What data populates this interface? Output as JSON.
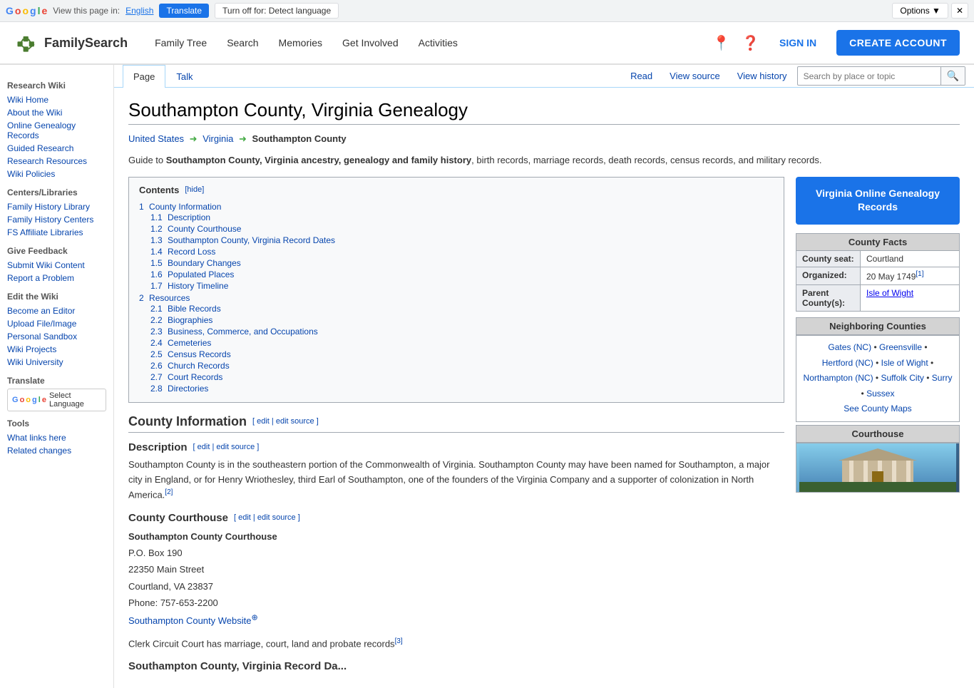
{
  "google_bar": {
    "view_text": "View this page in:",
    "language": "English",
    "translate_btn": "Translate",
    "turn_off_btn": "Turn off for: Detect language",
    "options_btn": "Options ▼",
    "close_btn": "✕"
  },
  "header": {
    "logo_text": "FamilySearch",
    "nav": [
      "Family Tree",
      "Search",
      "Memories",
      "Get Involved",
      "Activities"
    ],
    "sign_in": "SIGN IN",
    "create_account": "CREATE ACCOUNT"
  },
  "sidebar": {
    "research_wiki": "Research Wiki",
    "links1": [
      "Wiki Home",
      "About the Wiki",
      "Online Genealogy Records",
      "Guided Research",
      "Research Resources",
      "Wiki Policies"
    ],
    "centers_title": "Centers/Libraries",
    "links2": [
      "Family History Library",
      "Family History Centers",
      "FS Affiliate Libraries"
    ],
    "feedback_title": "Give Feedback",
    "links3": [
      "Submit Wiki Content",
      "Report a Problem"
    ],
    "edit_title": "Edit the Wiki",
    "links4": [
      "Become an Editor",
      "Upload File/Image",
      "Personal Sandbox",
      "Wiki Projects",
      "Wiki University"
    ],
    "translate_title": "Translate",
    "select_language": "Select Language",
    "tools_title": "Tools",
    "links5": [
      "What links here",
      "Related changes"
    ]
  },
  "tabs": {
    "page": "Page",
    "talk": "Talk",
    "read": "Read",
    "view_source": "View source",
    "view_history": "View history",
    "search_placeholder": "Search by place or topic"
  },
  "article": {
    "title": "Southampton County, Virginia Genealogy",
    "breadcrumb": {
      "us": "United States",
      "virginia": "Virginia",
      "current": "Southampton County"
    },
    "intro": "Guide to Southampton County, Virginia ancestry, genealogy and family history, birth records, marriage records, death records, census records, and military records.",
    "contents": {
      "title": "Contents",
      "hide_label": "[hide]",
      "items": [
        {
          "num": "1",
          "label": "County Information",
          "sub": [
            {
              "num": "1.1",
              "label": "Description"
            },
            {
              "num": "1.2",
              "label": "County Courthouse"
            },
            {
              "num": "1.3",
              "label": "Southampton County, Virginia Record Dates"
            },
            {
              "num": "1.4",
              "label": "Record Loss"
            },
            {
              "num": "1.5",
              "label": "Boundary Changes"
            },
            {
              "num": "1.6",
              "label": "Populated Places"
            },
            {
              "num": "1.7",
              "label": "History Timeline"
            }
          ]
        },
        {
          "num": "2",
          "label": "Resources",
          "sub": [
            {
              "num": "2.1",
              "label": "Bible Records"
            },
            {
              "num": "2.2",
              "label": "Biographies"
            },
            {
              "num": "2.3",
              "label": "Business, Commerce, and Occupations"
            },
            {
              "num": "2.4",
              "label": "Cemeteries"
            },
            {
              "num": "2.5",
              "label": "Census Records"
            },
            {
              "num": "2.6",
              "label": "Church Records"
            },
            {
              "num": "2.7",
              "label": "Court Records"
            },
            {
              "num": "2.8",
              "label": "Directories"
            }
          ]
        }
      ]
    },
    "county_info_title": "County Information",
    "description_title": "Description",
    "description_edit": "[ edit | edit source ]",
    "description_text": "Southampton County is in the southeastern portion of the Commonwealth of Virginia. Southampton County may have been named for Southampton, a major city in England, or for Henry Wriothesley, third Earl of Southampton, one of the founders of the Virginia Company and a supporter of colonization in North America.",
    "description_refs": "[2]",
    "courthouse_title": "County Courthouse",
    "courthouse_edit": "[ edit | edit source ]",
    "courthouse_name": "Southampton County Courthouse",
    "courthouse_po": "P.O. Box 190",
    "courthouse_street": "22350 Main Street",
    "courthouse_city": "Courtland, VA 23837",
    "courthouse_phone": "Phone: 757-653-2200",
    "courthouse_website": "Southampton County Website",
    "courthouse_website_sup": "⊕",
    "courthouse_clerk": "Clerk Circuit Court has marriage, court, land and probate records",
    "courthouse_clerk_ref": "[3]"
  },
  "sidebar_right": {
    "va_btn": "Virginia Online Genealogy\nRecords",
    "county_facts_title": "County Facts",
    "county_seat_label": "County seat:",
    "county_seat_value": "Courtland",
    "organized_label": "Organized:",
    "organized_value": "20 May 1749",
    "organized_ref": "[1]",
    "parent_label": "Parent County(s):",
    "parent_value": "Isle of Wight",
    "neighboring_title": "Neighboring Counties",
    "neighboring": "Gates (NC) • Greensville • Hertford (NC) • Isle of Wight • Northampton (NC) • Suffolk City • Surry • Sussex",
    "see_maps": "See County Maps",
    "courthouse_title": "Courthouse"
  }
}
